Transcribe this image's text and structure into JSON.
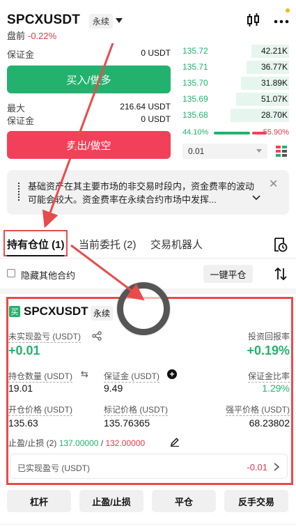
{
  "header": {
    "symbol": "SPCXUSDT",
    "contract_type": "永续",
    "session": "盘前",
    "change": "-0.22%"
  },
  "form": {
    "margin_label_1": "保证金",
    "margin_value_1": "0 USDT",
    "buy_label": "买入/做多",
    "max_label": "最大",
    "max_value": "216.64 USDT",
    "margin_label_2": "保证金",
    "margin_value_2": "0 USDT",
    "sell_label": "卖出/做空"
  },
  "orderbook": {
    "rows": [
      {
        "price": "135.72",
        "qty": "42.21K",
        "fill": 0.35
      },
      {
        "price": "135.71",
        "qty": "36.77K",
        "fill": 0.4
      },
      {
        "price": "135.70",
        "qty": "31.89K",
        "fill": 0.45
      },
      {
        "price": "135.69",
        "qty": "51.07K",
        "fill": 0.5
      },
      {
        "price": "135.68",
        "qty": "28.70K",
        "fill": 0.55
      }
    ],
    "buy_ratio": "44.10%",
    "sell_ratio": "55.90%",
    "precision": "0.01"
  },
  "notice": {
    "text": "基础资产在其主要市场的非交易时段内，资金费率的波动可能会较大。资金费率在永续合约市场中发挥..."
  },
  "tabs": {
    "positions": "持有仓位 (1)",
    "orders": "当前委托 (2)",
    "bots": "交易机器人"
  },
  "controls": {
    "hide_other": "隐藏其他合约",
    "close_all": "一键平仓"
  },
  "position": {
    "side_badge": "买",
    "symbol": "SPCXUSDT",
    "type": "永续",
    "unrealized_label": "未实现盈亏 (USDT)",
    "unrealized_value": "+0.01",
    "roi_label": "投资回报率",
    "roi_value": "+0.19%",
    "size_label": "持仓数量 (USDT)",
    "size_value": "19.01",
    "margin_label": "保证金 (USDT)",
    "margin_value": "9.49",
    "margin_ratio_label": "保证金比率",
    "margin_ratio_value": "1.29%",
    "entry_label": "开仓价格 (USDT)",
    "entry_value": "135.63",
    "mark_label": "标记价格 (USDT)",
    "mark_value": "135.76365",
    "liq_label": "强平价格 (USDT)",
    "liq_value": "68.23802",
    "tpsl_label": "止盈/止损 (2)",
    "tp_value": "137.00000",
    "tpsl_sep": "/",
    "sl_value": "132.00000",
    "realized_label": "已实现盈亏 (USDT)",
    "realized_value": "-0.01"
  },
  "actions": {
    "leverage": "杠杆",
    "tpsl": "止盈/止损",
    "close": "平仓",
    "reverse": "反手交易"
  },
  "colors": {
    "green": "#23b26d",
    "red": "#f3405a",
    "annotation": "#e84b4b"
  }
}
